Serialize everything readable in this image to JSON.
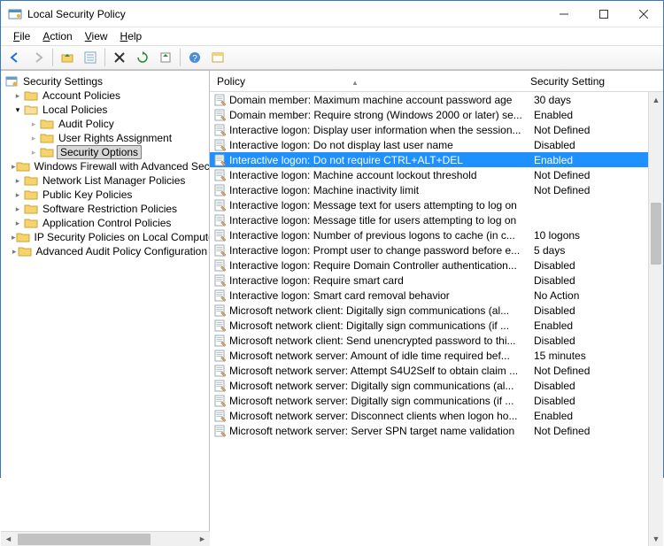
{
  "window": {
    "title": "Local Security Policy"
  },
  "menubar": {
    "file": "File",
    "action": "Action",
    "view": "View",
    "help": "Help"
  },
  "tree": {
    "root": "Security Settings",
    "items": [
      {
        "label": "Account Policies"
      },
      {
        "label": "Local Policies",
        "expanded": true,
        "children": [
          {
            "label": "Audit Policy"
          },
          {
            "label": "User Rights Assignment"
          },
          {
            "label": "Security Options",
            "selected": true
          }
        ]
      },
      {
        "label": "Windows Firewall with Advanced Secu"
      },
      {
        "label": "Network List Manager Policies"
      },
      {
        "label": "Public Key Policies"
      },
      {
        "label": "Software Restriction Policies"
      },
      {
        "label": "Application Control Policies"
      },
      {
        "label": "IP Security Policies on Local Compute"
      },
      {
        "label": "Advanced Audit Policy Configuration"
      }
    ]
  },
  "list": {
    "header": {
      "policy": "Policy",
      "setting": "Security Setting"
    },
    "rows": [
      {
        "policy": "Domain member: Maximum machine account password age",
        "setting": "30 days"
      },
      {
        "policy": "Domain member: Require strong (Windows 2000 or later) se...",
        "setting": "Enabled"
      },
      {
        "policy": "Interactive logon: Display user information when the session...",
        "setting": "Not Defined"
      },
      {
        "policy": "Interactive logon: Do not display last user name",
        "setting": "Disabled"
      },
      {
        "policy": "Interactive logon: Do not require CTRL+ALT+DEL",
        "setting": "Enabled",
        "selected": true
      },
      {
        "policy": "Interactive logon: Machine account lockout threshold",
        "setting": "Not Defined"
      },
      {
        "policy": "Interactive logon: Machine inactivity limit",
        "setting": "Not Defined"
      },
      {
        "policy": "Interactive logon: Message text for users attempting to log on",
        "setting": ""
      },
      {
        "policy": "Interactive logon: Message title for users attempting to log on",
        "setting": ""
      },
      {
        "policy": "Interactive logon: Number of previous logons to cache (in c...",
        "setting": "10 logons"
      },
      {
        "policy": "Interactive logon: Prompt user to change password before e...",
        "setting": "5 days"
      },
      {
        "policy": "Interactive logon: Require Domain Controller authentication...",
        "setting": "Disabled"
      },
      {
        "policy": "Interactive logon: Require smart card",
        "setting": "Disabled"
      },
      {
        "policy": "Interactive logon: Smart card removal behavior",
        "setting": "No Action"
      },
      {
        "policy": "Microsoft network client: Digitally sign communications (al...",
        "setting": "Disabled"
      },
      {
        "policy": "Microsoft network client: Digitally sign communications (if ...",
        "setting": "Enabled"
      },
      {
        "policy": "Microsoft network client: Send unencrypted password to thi...",
        "setting": "Disabled"
      },
      {
        "policy": "Microsoft network server: Amount of idle time required bef...",
        "setting": "15 minutes"
      },
      {
        "policy": "Microsoft network server: Attempt S4U2Self to obtain claim ...",
        "setting": "Not Defined"
      },
      {
        "policy": "Microsoft network server: Digitally sign communications (al...",
        "setting": "Disabled"
      },
      {
        "policy": "Microsoft network server: Digitally sign communications (if ...",
        "setting": "Disabled"
      },
      {
        "policy": "Microsoft network server: Disconnect clients when logon ho...",
        "setting": "Enabled"
      },
      {
        "policy": "Microsoft network server: Server SPN target name validation",
        "setting": "Not Defined"
      }
    ]
  }
}
